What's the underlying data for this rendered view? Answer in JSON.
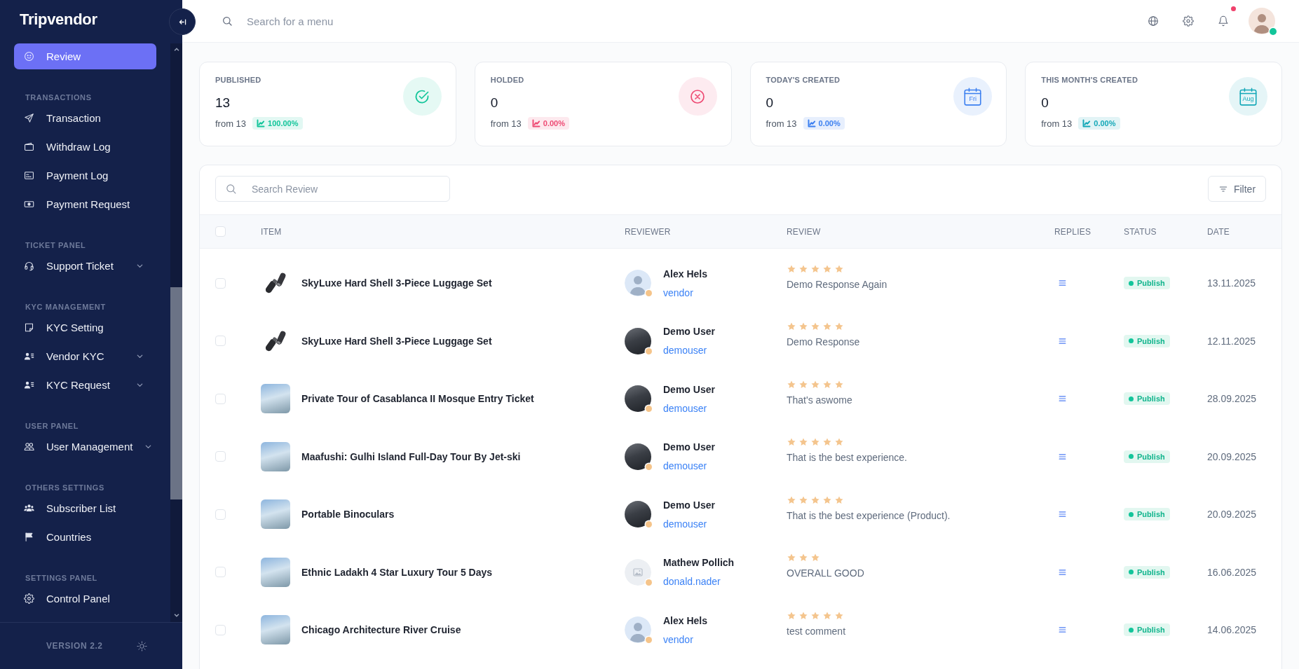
{
  "sidebar": {
    "logo": "Tripvendor",
    "items": [
      {
        "kind": "link",
        "label": "Review",
        "selected": true
      },
      {
        "kind": "heading",
        "label": "TRANSACTIONS"
      },
      {
        "kind": "link",
        "label": "Transaction",
        "selected": false
      },
      {
        "kind": "link",
        "label": "Withdraw Log",
        "selected": false
      },
      {
        "kind": "link",
        "label": "Payment Log",
        "selected": false
      },
      {
        "kind": "link",
        "label": "Payment Request",
        "selected": false
      },
      {
        "kind": "heading",
        "label": "TICKET PANEL"
      },
      {
        "kind": "group",
        "label": "Support Ticket",
        "selected": false
      },
      {
        "kind": "heading",
        "label": "KYC MANAGEMENT"
      },
      {
        "kind": "link",
        "label": "KYC Setting",
        "selected": false
      },
      {
        "kind": "group",
        "label": "Vendor KYC",
        "selected": false
      },
      {
        "kind": "group",
        "label": "KYC Request",
        "selected": false
      },
      {
        "kind": "heading",
        "label": "USER PANEL"
      },
      {
        "kind": "group",
        "label": "User Management",
        "selected": false
      },
      {
        "kind": "heading",
        "label": "OTHERS SETTINGS"
      },
      {
        "kind": "link",
        "label": "Subscriber List",
        "selected": false
      },
      {
        "kind": "link",
        "label": "Countries",
        "selected": false
      },
      {
        "kind": "heading",
        "label": "SETTINGS PANEL"
      },
      {
        "kind": "link",
        "label": "Control Panel",
        "selected": false
      }
    ],
    "version": "VERSION 2.2"
  },
  "topbar": {
    "search": {
      "placeholder": "Search for a menu"
    },
    "notification_dot": true,
    "user_online": true
  },
  "stats": [
    {
      "kind": "check",
      "label": "PUBLISHED",
      "value": "13",
      "from": "from 13",
      "change": "100.00%",
      "color": "#12c59a"
    },
    {
      "kind": "cross",
      "label": "HOLDED",
      "value": "0",
      "from": "from 13",
      "change": "0.00%",
      "color": "#ee4b74"
    },
    {
      "kind": "calendar",
      "label": "TODAY'S CREATED",
      "value": "0",
      "from": "from 13",
      "change": "0.00%",
      "color": "#3b7ff0",
      "icon_text": "Fri"
    },
    {
      "kind": "calendar",
      "label": "THIS MONTH'S CREATED",
      "value": "0",
      "from": "from 13",
      "change": "0.00%",
      "color": "#14a8b8",
      "icon_text": "Aug"
    }
  ],
  "table": {
    "search": {
      "placeholder": "Search Review"
    },
    "filter": "Filter",
    "header_checked": false,
    "columns": [
      "ITEM",
      "REVIEWER",
      "REVIEW",
      "REPLIES",
      "STATUS",
      "DATE"
    ],
    "rows": [
      {
        "checked": false,
        "thumb": {
          "kind": "product"
        },
        "item": "SkyLuxe Hard Shell 3-Piece Luggage Set",
        "avatar": {
          "kind": "person"
        },
        "reviewer": "Alex Hels",
        "online": false,
        "username": "vendor",
        "stars": 5,
        "review": "Demo Response Again",
        "status": "Publish",
        "date": "13.11.2025"
      },
      {
        "checked": false,
        "thumb": {
          "kind": "product"
        },
        "item": "SkyLuxe Hard Shell 3-Piece Luggage Set",
        "avatar": {
          "kind": "photo"
        },
        "reviewer": "Demo User",
        "online": false,
        "username": "demouser",
        "stars": 5,
        "review": "Demo Response",
        "status": "Publish",
        "date": "12.11.2025"
      },
      {
        "checked": false,
        "thumb": {
          "kind": "photo"
        },
        "item": "Private Tour of Casablanca II Mosque Entry Ticket",
        "avatar": {
          "kind": "photo"
        },
        "reviewer": "Demo User",
        "online": false,
        "username": "demouser",
        "stars": 5,
        "review": "That's aswome",
        "status": "Publish",
        "date": "28.09.2025"
      },
      {
        "checked": false,
        "thumb": {
          "kind": "photo"
        },
        "item": "Maafushi: Gulhi Island Full-Day Tour By Jet-ski",
        "avatar": {
          "kind": "photo"
        },
        "reviewer": "Demo User",
        "online": false,
        "username": "demouser",
        "stars": 5,
        "review": "That is the best experience.",
        "status": "Publish",
        "date": "20.09.2025"
      },
      {
        "checked": false,
        "thumb": {
          "kind": "photo"
        },
        "item": "Portable Binoculars",
        "avatar": {
          "kind": "photo"
        },
        "reviewer": "Demo User",
        "online": false,
        "username": "demouser",
        "stars": 5,
        "review": "That is the best experience (Product).",
        "status": "Publish",
        "date": "20.09.2025"
      },
      {
        "checked": false,
        "thumb": {
          "kind": "photo"
        },
        "item": "Ethnic Ladakh 4 Star Luxury Tour 5 Days",
        "avatar": {
          "kind": "placeholder"
        },
        "reviewer": "Mathew Pollich",
        "online": false,
        "username": "donald.nader",
        "stars": 3,
        "review": "OVERALL GOOD",
        "status": "Publish",
        "date": "16.06.2025"
      },
      {
        "checked": false,
        "thumb": {
          "kind": "photo"
        },
        "item": "Chicago Architecture River Cruise",
        "avatar": {
          "kind": "person"
        },
        "reviewer": "Alex Hels",
        "online": false,
        "username": "vendor",
        "stars": 5,
        "review": "test comment",
        "status": "Publish",
        "date": "14.06.2025"
      }
    ]
  }
}
